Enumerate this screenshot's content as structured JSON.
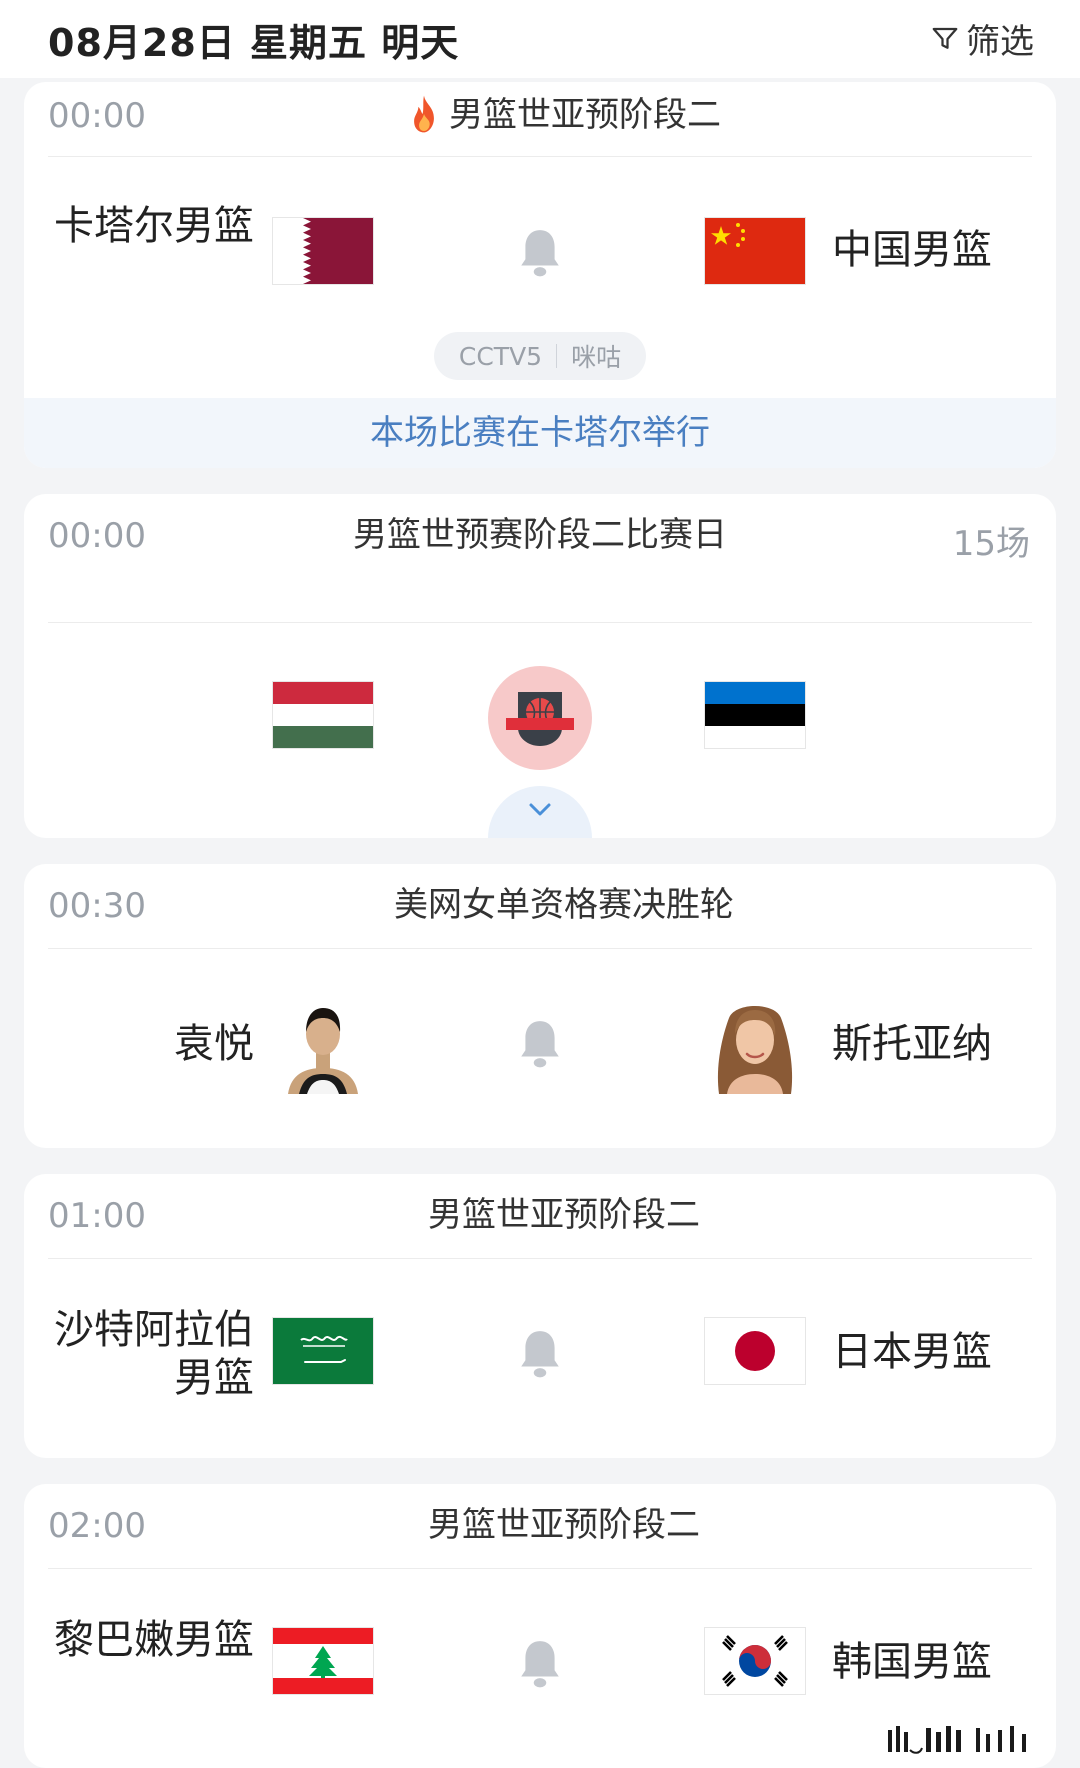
{
  "header": {
    "date": "08月28日 星期五 明天",
    "filter_label": "筛选"
  },
  "matches": [
    {
      "time": "00:00",
      "title": "男篮世亚预阶段二",
      "hot": true,
      "home": "卡塔尔男篮",
      "away": "中国男篮",
      "channels": [
        "CCTV5",
        "咪咕"
      ],
      "venue_note": "本场比赛在卡塔尔举行"
    },
    {
      "time": "00:00",
      "title": "男篮世预赛阶段二比赛日",
      "count": "15场"
    },
    {
      "time": "00:30",
      "title": "美网女单资格赛决胜轮",
      "home": "袁悦",
      "away": "斯托亚纳"
    },
    {
      "time": "01:00",
      "title": "男篮世亚预阶段二",
      "home": "沙特阿拉伯男篮",
      "away": "日本男篮"
    },
    {
      "time": "02:00",
      "title": "男篮世亚预阶段二",
      "home": "黎巴嫩男篮",
      "away": "韩国男篮"
    }
  ],
  "colors": {
    "accent_blue": "#4a7fc1",
    "muted_text": "#9aa0a8",
    "fire": "#f0562b"
  }
}
